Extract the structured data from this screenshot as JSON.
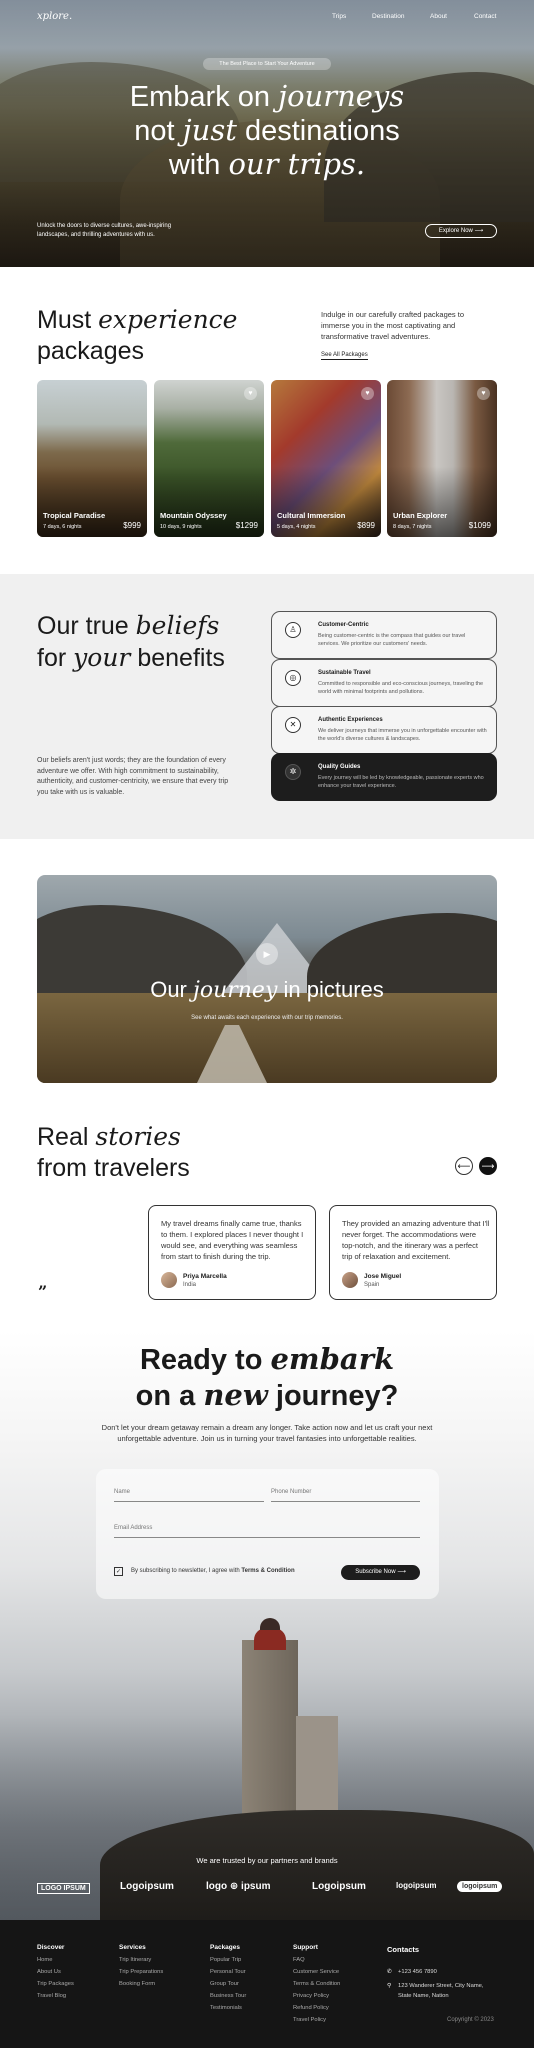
{
  "nav": {
    "logo": "xplore.",
    "links": [
      "Trips",
      "Destination",
      "About",
      "Contact"
    ]
  },
  "hero": {
    "pill": "The Best Place to Start Your Adventure",
    "title_a": "Embark on",
    "title_b": "journeys",
    "title_c": "not",
    "title_d": "just",
    "title_e": "destinations",
    "title_f": "with",
    "title_g": "our trips.",
    "subtitle": "Unlock the doors to diverse cultures, awe-inspiring landscapes, and thrilling adventures with us.",
    "cta": "Explore Now ⟶"
  },
  "packages": {
    "title_a": "Must",
    "title_b": "experience",
    "title_c": "packages",
    "description": "Indulge in our carefully crafted packages to immerse you in the most captivating and transformative travel adventures.",
    "link": "See All Packages",
    "items": [
      {
        "name": "Tropical Paradise",
        "duration": "7 days, 6 nights",
        "price": "$999"
      },
      {
        "name": "Mountain Odyssey",
        "duration": "10 days, 9 nights",
        "price": "$1299"
      },
      {
        "name": "Cultural Immersion",
        "duration": "5 days, 4 nights",
        "price": "$899"
      },
      {
        "name": "Urban Explorer",
        "duration": "8 days, 7 nights",
        "price": "$1099"
      }
    ]
  },
  "beliefs": {
    "title_a": "Our true",
    "title_b": "beliefs",
    "title_c": "for",
    "title_d": "your",
    "title_e": "benefits",
    "description": "Our beliefs aren't just words; they are the foundation of every adventure we offer. With high commitment to sustainability, authenticity, and customer-centricity, we ensure that every trip you take with us is valuable.",
    "items": [
      {
        "title": "Customer-Centric",
        "text": "Being customer-centric is the compass that guides our travel services. We prioritize our customers' needs."
      },
      {
        "title": "Sustainable Travel",
        "text": "Committed to responsible and eco-conscious journeys, traveling the world with minimal footprints and pollutions."
      },
      {
        "title": "Authentic Experiences",
        "text": "We deliver journeys that immerse you in unforgettable encounter with the world's diverse cultures & landscapes."
      },
      {
        "title": "Quality Guides",
        "text": "Every journey will be led by knowledgeable, passionate experts who enhance your travel experience."
      }
    ]
  },
  "pictures": {
    "title_a": "Our",
    "title_b": "journey",
    "title_c": "in pictures",
    "subtitle": "See what awaits each experience with our trip memories."
  },
  "stories": {
    "title_a": "Real",
    "title_b": "stories",
    "title_c": "from travelers",
    "quote_mark": "”",
    "prev": "⟵",
    "next": "⟶",
    "items": [
      {
        "text": "My travel dreams finally came true, thanks to them. I explored places I never thought I would see, and everything was seamless from start to finish during the trip.",
        "author": "Priya Marcella",
        "location": "India"
      },
      {
        "text": "They provided an amazing adventure that I'll never forget. The accommodations were top-notch, and the itinerary was a perfect trip of relaxation and excitement.",
        "author": "Jose Miguel",
        "location": "Spain"
      }
    ]
  },
  "cta": {
    "title_a": "Ready to",
    "title_b": "embark",
    "title_c": "on a",
    "title_d": "new",
    "title_e": "journey?",
    "subtitle": "Don't let your dream getaway remain a dream any longer. Take action now and let us craft your next unforgettable adventure. Join us in turning your travel fantasies into unforgettable realities.",
    "form": {
      "name_placeholder": "Name",
      "phone_placeholder": "Phone Number",
      "email_placeholder": "Email Address",
      "consent_prefix": "By subscribing to newsletter, I agree with ",
      "consent_terms": "Terms & Condition",
      "submit": "Subscribe Now ⟶"
    },
    "trusted": "We are trusted by our partners and brands",
    "logos": [
      "LOGO IPSUM",
      "Logoipsum",
      "logo ⊕ ipsum",
      "Logoipsum",
      "logoipsum",
      "logoipsum"
    ]
  },
  "footer": {
    "columns": [
      {
        "title": "Discover",
        "links": [
          "Home",
          "About Us",
          "Trip Packages",
          "Travel Blog"
        ]
      },
      {
        "title": "Services",
        "links": [
          "Trip Itinerary",
          "Trip Preparations",
          "Booking Form"
        ]
      },
      {
        "title": "Packages",
        "links": [
          "Popular Trip",
          "Personal Tour",
          "Group Tour",
          "Business Tour",
          "Testimonials"
        ]
      },
      {
        "title": "Support",
        "links": [
          "FAQ",
          "Customer Service",
          "Terms & Condition",
          "Privacy Policy",
          "Refund Policy",
          "Travel Policy"
        ]
      }
    ],
    "contacts_title": "Contacts",
    "phone": "+123 456 7890",
    "address_1": "123 Wanderer Street, City Name,",
    "address_2": "State Name, Nation",
    "copyright": "Copyright © 2023"
  }
}
